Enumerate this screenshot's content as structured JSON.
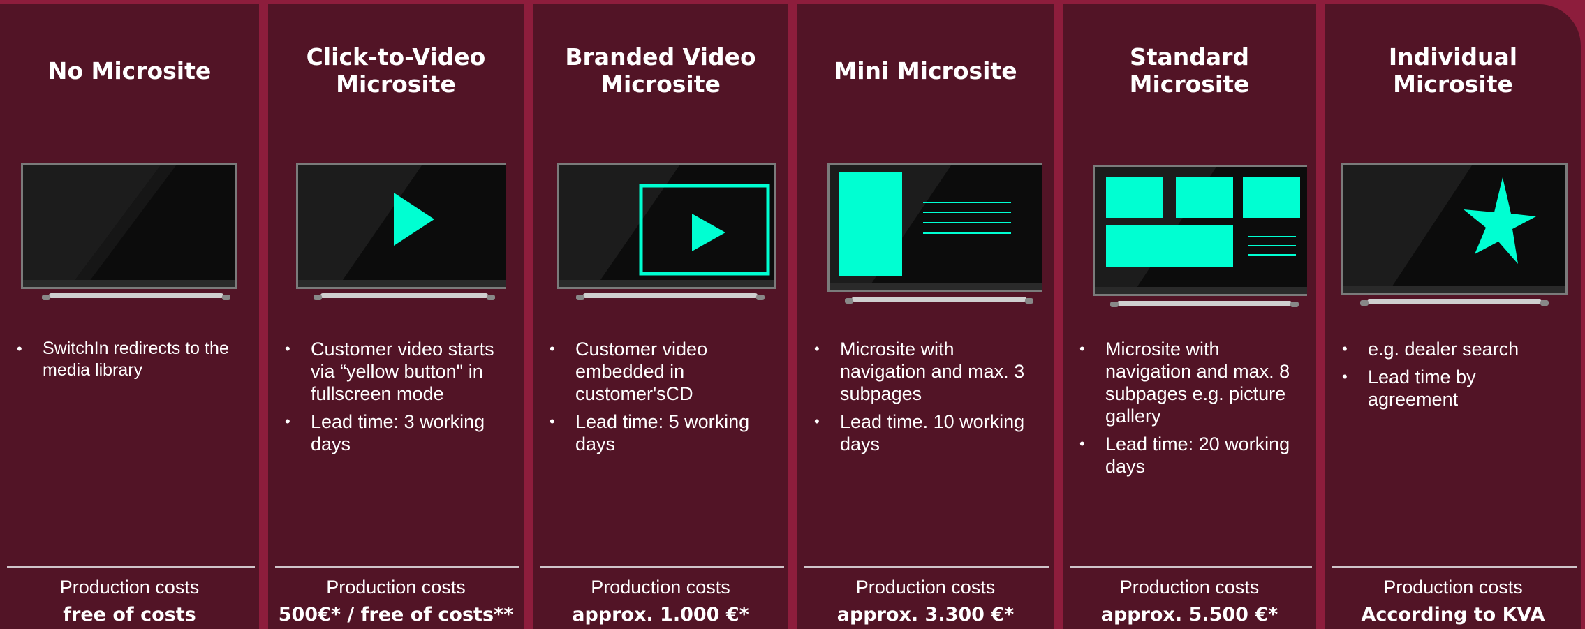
{
  "accent_color": "#00ffd2",
  "columns": [
    {
      "title": "No Microsite",
      "screen_icon": "blank-screen-icon",
      "bullets": [
        "SwitchIn redirects to the media library"
      ],
      "cost_label": "Production costs",
      "cost_value": "free of costs"
    },
    {
      "title": "Click-to-Video Microsite",
      "screen_icon": "play-icon",
      "bullets": [
        "Customer video starts via “yellow button\" in fullscreen mode",
        "Lead time: 3 working days"
      ],
      "cost_label": "Production costs",
      "cost_value": "500€* / free of costs**"
    },
    {
      "title": "Branded Video Microsite",
      "screen_icon": "framed-play-icon",
      "bullets": [
        "Customer video embedded in customer'sCD",
        "Lead time: 5 working days"
      ],
      "cost_label": "Production costs",
      "cost_value": "approx. 1.000 €*"
    },
    {
      "title": "Mini Microsite",
      "screen_icon": "mini-layout-icon",
      "bullets": [
        "Microsite with navigation and max. 3 subpages",
        "Lead time. 10 working days"
      ],
      "cost_label": "Production costs",
      "cost_value": "approx. 3.300 €*"
    },
    {
      "title": "Standard Microsite",
      "screen_icon": "standard-layout-icon",
      "bullets": [
        "Microsite with navigation and max. 8 subpages  e.g. picture gallery",
        "Lead time: 20 working days"
      ],
      "cost_label": "Production costs",
      "cost_value": "approx. 5.500 €*"
    },
    {
      "title": "Individual Microsite",
      "screen_icon": "star-icon",
      "bullets": [
        "e.g. dealer search",
        "Lead time by agreement"
      ],
      "cost_label": "Production costs",
      "cost_value": "According to KVA"
    }
  ]
}
